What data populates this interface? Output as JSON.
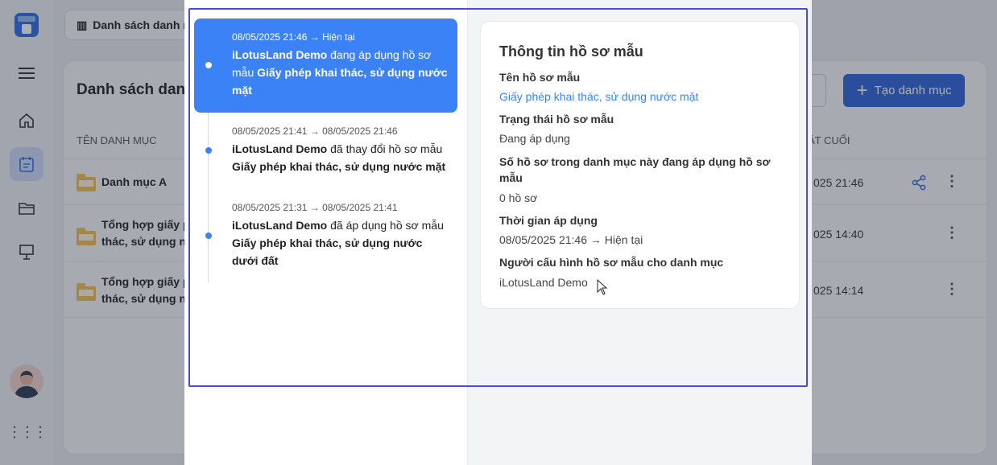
{
  "background": {
    "top_tab_label": "Danh sách danh m",
    "page_title": "Danh sách danh",
    "create_button": "Tạo danh mục",
    "column_name": "TÊN DANH MỤC",
    "column_updated": "ẬT CUỐI",
    "rows": [
      {
        "name": "Danh mục A",
        "updated": "025 21:46"
      },
      {
        "name": "Tổng hợp giấy p\nthác, sử dụng nư",
        "updated": "025 14:40"
      },
      {
        "name": "Tổng hợp giấy p\nthác, sử dụng n",
        "updated": "025 14:14"
      }
    ],
    "sidebar_icons": [
      "menu-icon",
      "home-icon",
      "calendar-icon",
      "folder-icon",
      "presentation-icon"
    ],
    "accent": "#2f63d8"
  },
  "history": {
    "items": [
      {
        "time": "08/05/2025 21:46 → Hiện tại",
        "user": "iLotusLand Demo",
        "action": " đang áp dụng hồ sơ mẫu ",
        "template": "Giấy phép khai thác, sử dụng nước mặt",
        "current": true
      },
      {
        "time": "08/05/2025 21:41 → 08/05/2025 21:46",
        "user": "iLotusLand Demo",
        "action": " đã thay đổi hồ sơ mẫu ",
        "template": "Giấy phép khai thác, sử dụng nước mặt",
        "current": false
      },
      {
        "time": "08/05/2025 21:31 → 08/05/2025 21:41",
        "user": "iLotusLand Demo",
        "action": " đã áp dụng hồ sơ mẫu ",
        "template": "Giấy phép khai thác, sử dụng nước dưới đất",
        "current": false
      }
    ],
    "accent": "#3b82f6"
  },
  "info": {
    "title": "Thông tin hồ sơ mẫu",
    "template_name_label": "Tên hồ sơ mẫu",
    "template_name_value": "Giấy phép khai thác, sử dụng nước mặt",
    "status_label": "Trạng thái hồ sơ mẫu",
    "status_value": "Đang áp dụng",
    "count_label": "Số hồ sơ trong danh mục này đang áp dụng hồ sơ mẫu",
    "count_value": "0 hồ sơ",
    "period_label": "Thời gian áp dụng",
    "period_value": "08/05/2025 21:46 → Hiện tại",
    "configurer_label": "Người cấu hình hồ sơ mẫu cho danh mục",
    "configurer_value": "iLotusLand Demo",
    "link_color": "#3b82f6"
  }
}
